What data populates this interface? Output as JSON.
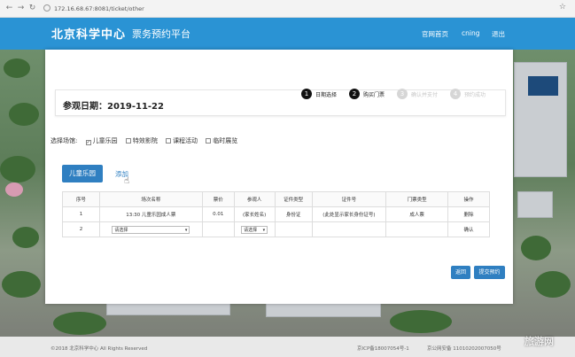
{
  "browser": {
    "address": "172.16.68.67:8081/ticket/other"
  },
  "header": {
    "logo": "北京科学中心",
    "subtitle": "票务预约平台",
    "links": [
      "官网首页",
      "cning",
      "退出"
    ]
  },
  "visit": {
    "date_label": "参观日期：",
    "date_value": "2019-11-22"
  },
  "steps": [
    {
      "num": "1",
      "label": "日期选择",
      "active": true
    },
    {
      "num": "2",
      "label": "购买门票",
      "active": true
    },
    {
      "num": "3",
      "label": "确认并支付",
      "active": false
    },
    {
      "num": "4",
      "label": "预约成功",
      "active": false
    }
  ],
  "venue": {
    "label": "选择场馆:",
    "options": [
      {
        "label": "儿童乐园",
        "checked": true
      },
      {
        "label": "特效影院",
        "checked": false
      },
      {
        "label": "课程活动",
        "checked": false
      },
      {
        "label": "临时展览",
        "checked": false
      }
    ]
  },
  "tabs": {
    "active": "儿童乐园",
    "add": "添加"
  },
  "table": {
    "headers": [
      "序号",
      "场次名称",
      "票价",
      "参观人",
      "证件类型",
      "证件号",
      "门票类型",
      "操作"
    ],
    "rows": [
      {
        "no": "1",
        "session": "13:30 儿童乐园成人票",
        "price": "0.01",
        "visitor": "(家长姓名)",
        "id_type": "身份证",
        "id_no": "(此处显示家长身份证号)",
        "ticket_type": "成人票",
        "action": "删除"
      },
      {
        "no": "2",
        "session": "请选择",
        "price": "",
        "visitor": "请选择",
        "id_type": "",
        "id_no": "",
        "ticket_type": "",
        "action": "确认"
      }
    ]
  },
  "buttons": {
    "back": "返回",
    "submit": "提交预约"
  },
  "footer": {
    "copyright": "©2018 北京科学中心 All Rights Reserved",
    "icp": "京ICP备18007054号-1",
    "police": "京公网安备 11010202007050号"
  },
  "watermark": "旅游网",
  "colors": {
    "header": "#2a93d4",
    "accent": "#2f7fc1",
    "warning": "#d3282b"
  }
}
